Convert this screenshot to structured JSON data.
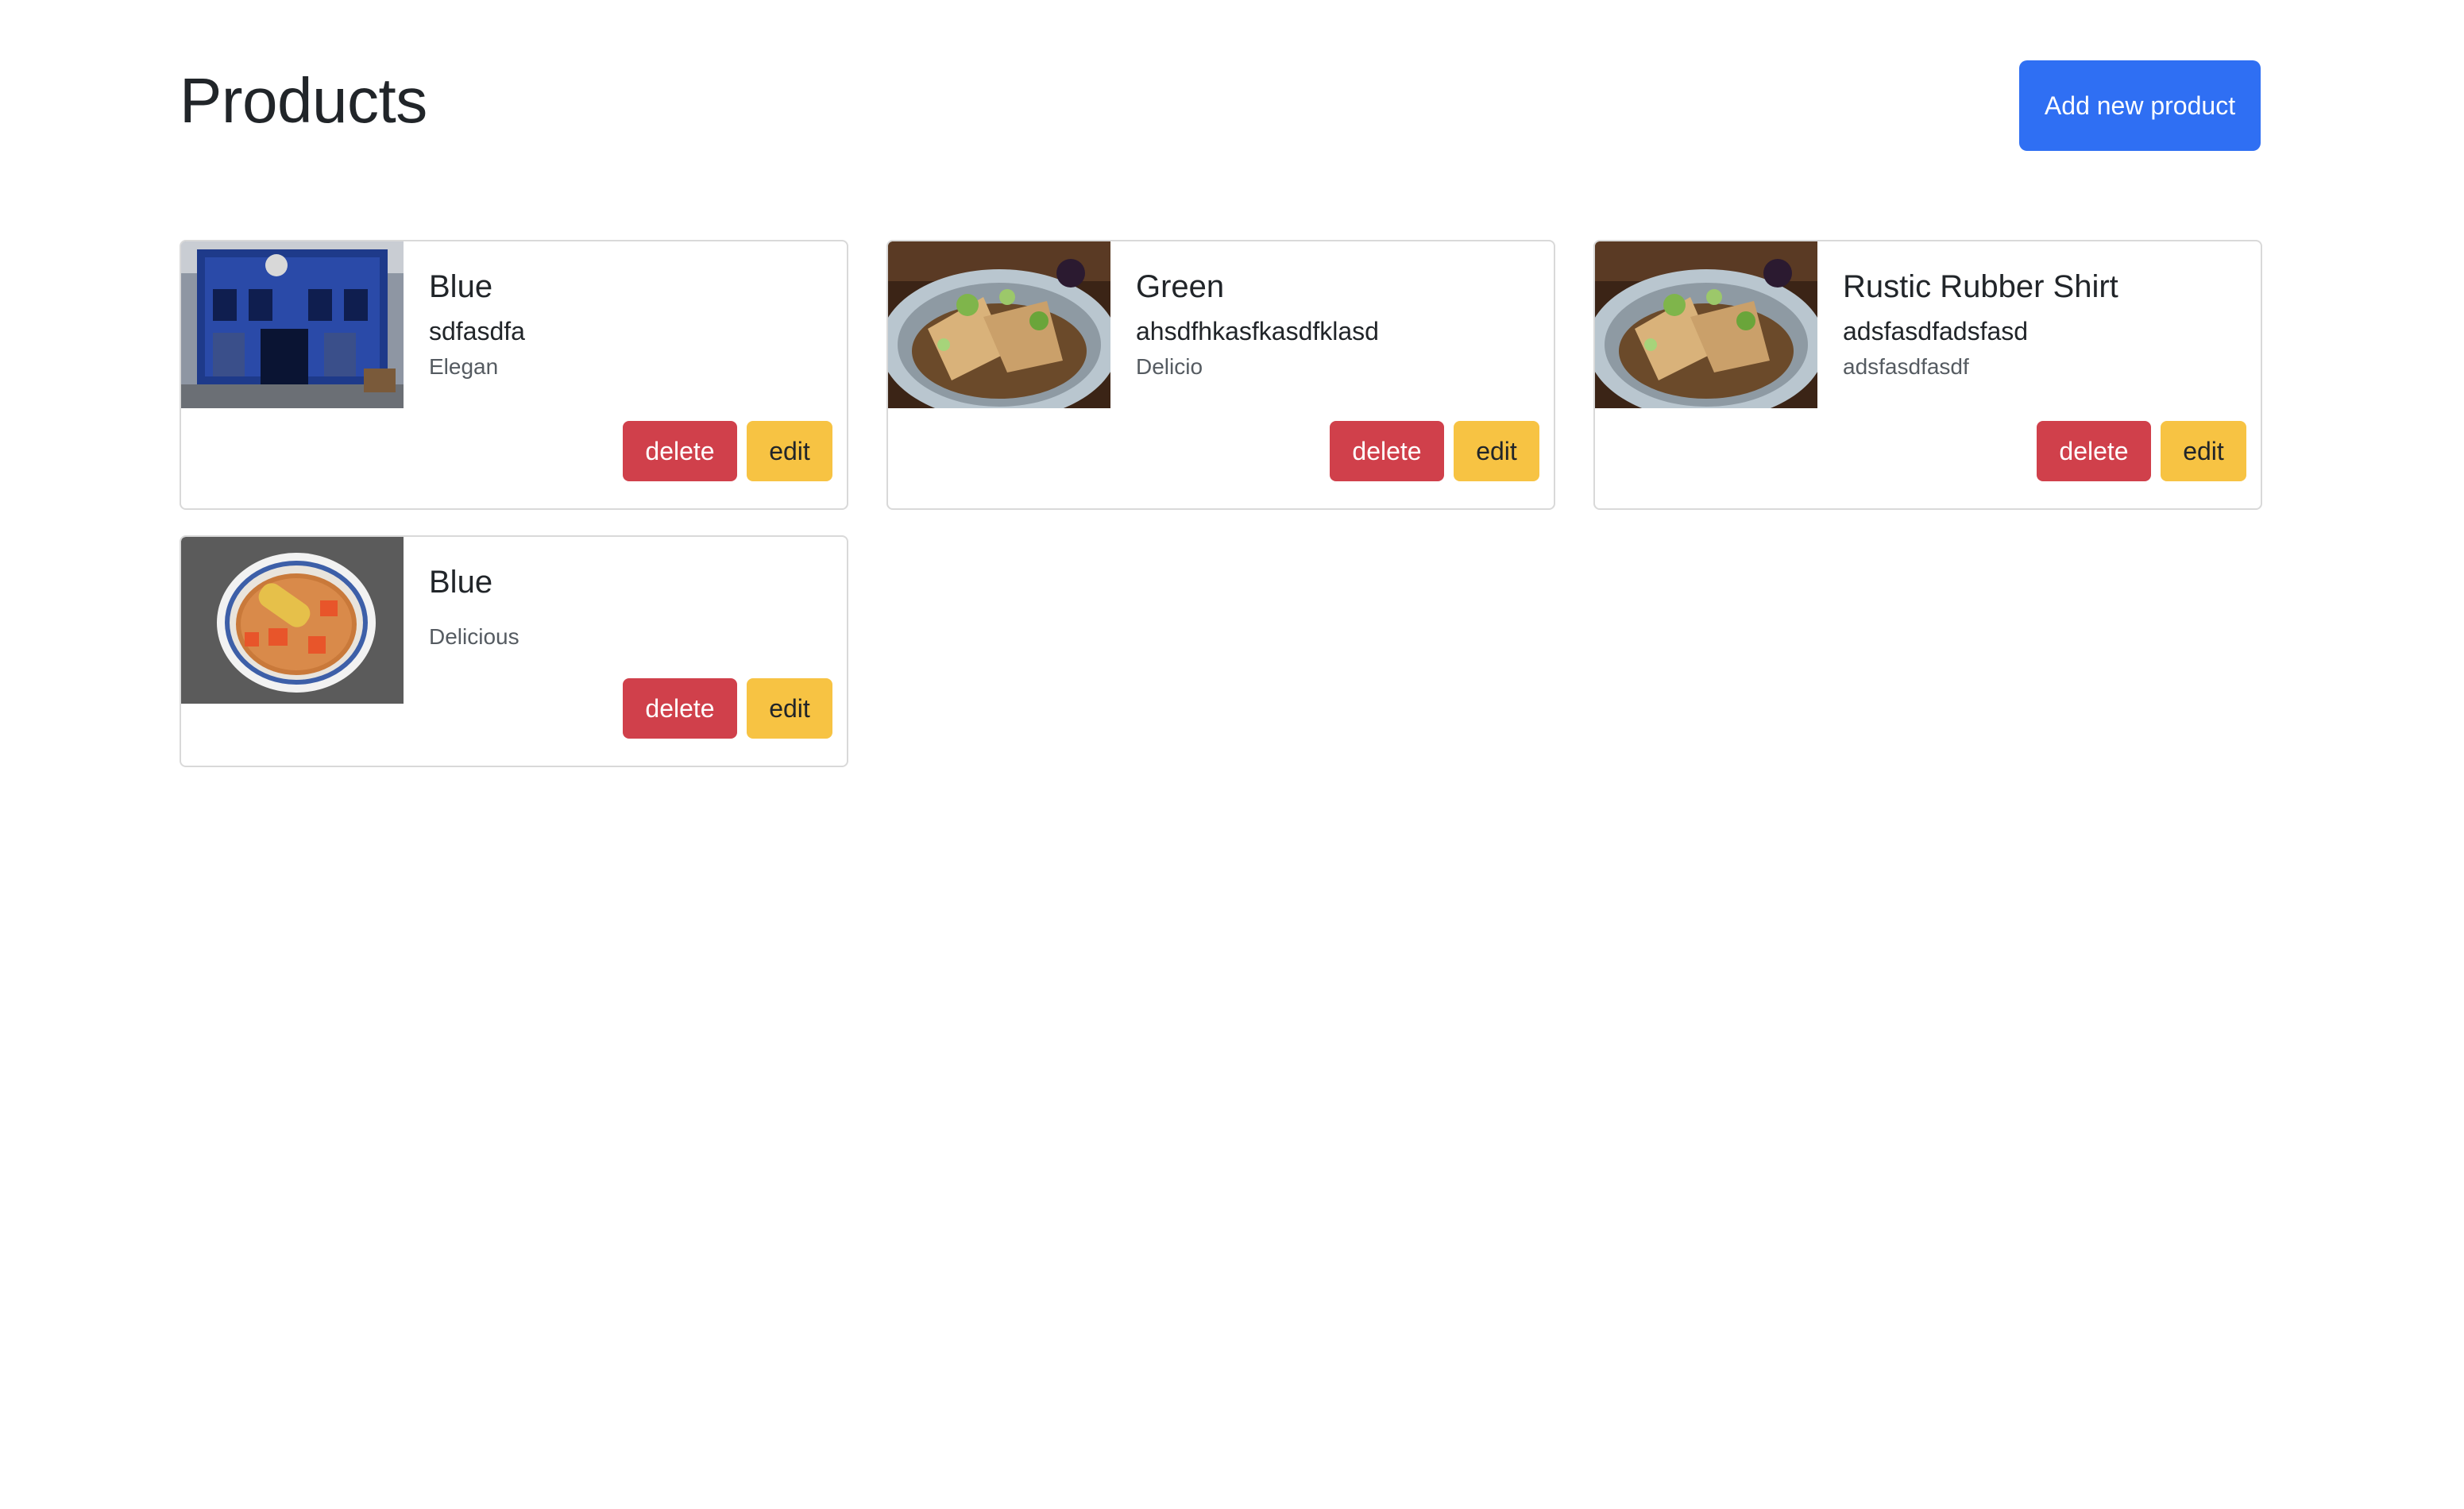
{
  "header": {
    "title": "Products",
    "add_button_label": "Add new product"
  },
  "colors": {
    "primary": "#2f6ff3",
    "danger": "#d0404b",
    "warning": "#f7c343"
  },
  "products": [
    {
      "title": "Blue",
      "subtitle": "sdfasdfa",
      "text": "Elegan",
      "image": "blue-building-photo",
      "delete_label": "delete",
      "edit_label": "edit"
    },
    {
      "title": "Green",
      "subtitle": "ahsdfhkasfkasdfklasd",
      "text": "Delicio",
      "image": "tofu-dish-photo",
      "delete_label": "delete",
      "edit_label": "edit"
    },
    {
      "title": "Rustic Rubber Shirt",
      "subtitle": "adsfasdfadsfasd",
      "text": "adsfasdfasdf",
      "image": "tofu-dish-photo",
      "delete_label": "delete",
      "edit_label": "edit"
    },
    {
      "title": "Blue",
      "subtitle": "",
      "text": "Delicious",
      "image": "soup-bowl-photo",
      "delete_label": "delete",
      "edit_label": "edit"
    }
  ]
}
